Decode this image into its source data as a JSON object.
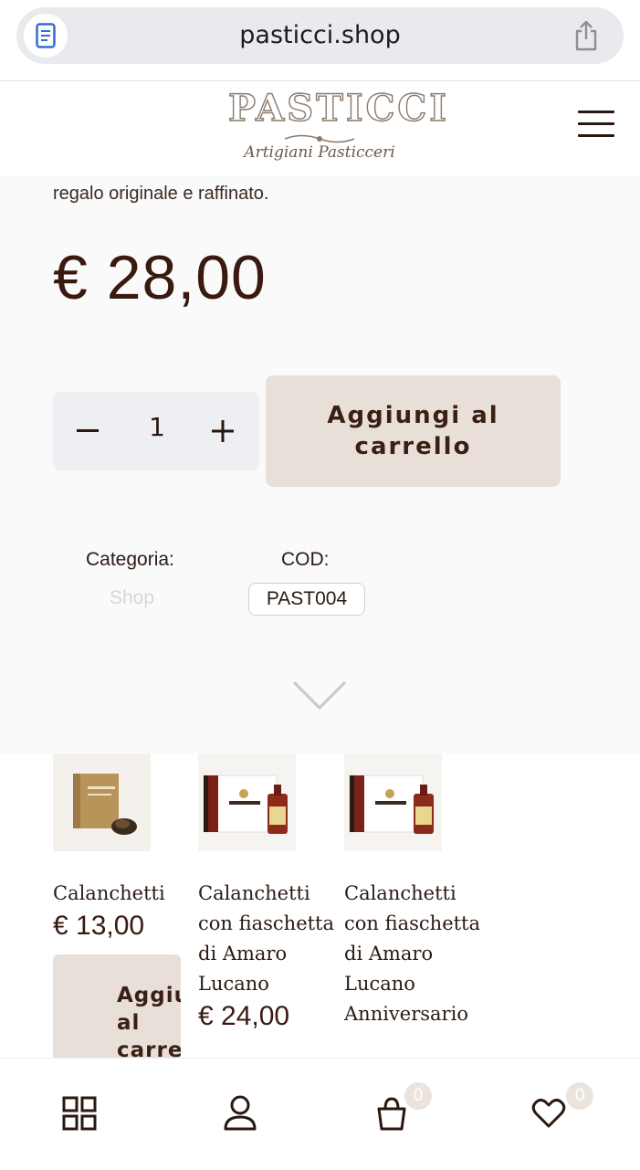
{
  "browser": {
    "url": "pasticci.shop",
    "reader_icon": "reader-mode-icon",
    "share_icon": "share-icon"
  },
  "header": {
    "logo_title": "PASTICCI",
    "logo_subtitle": "Artigiani Pasticceri",
    "menu_icon": "hamburger-menu-icon"
  },
  "product": {
    "description_tail": "regalo originale e raffinato.",
    "price": "€ 28,00",
    "quantity": "1",
    "add_to_cart_label": "Aggiungi al carrello",
    "category_label": "Categoria:",
    "category_value": "Shop",
    "code_label": "COD:",
    "code_value": "PAST004"
  },
  "related": [
    {
      "name": "Calanchetti",
      "price": "€ 13,00",
      "button_label": "Aggiungi al carrello"
    },
    {
      "name": "Calanchetti con fiaschetta di Amaro Lucano",
      "price": "€ 24,00"
    },
    {
      "name": "Calanchetti con fiaschetta di Amaro Lucano Anniversario"
    }
  ],
  "tabbar": {
    "items": [
      {
        "icon": "grid-icon",
        "label": ""
      },
      {
        "icon": "user-icon",
        "label": ""
      },
      {
        "icon": "cart-icon",
        "badge": "0"
      },
      {
        "icon": "heart-icon",
        "badge": "0"
      }
    ]
  },
  "colors": {
    "accent": "#e8e0d8",
    "text_dark": "#3a1a10",
    "stepper_bg": "#eeeff3",
    "badge_bg": "#ebe3dd"
  }
}
